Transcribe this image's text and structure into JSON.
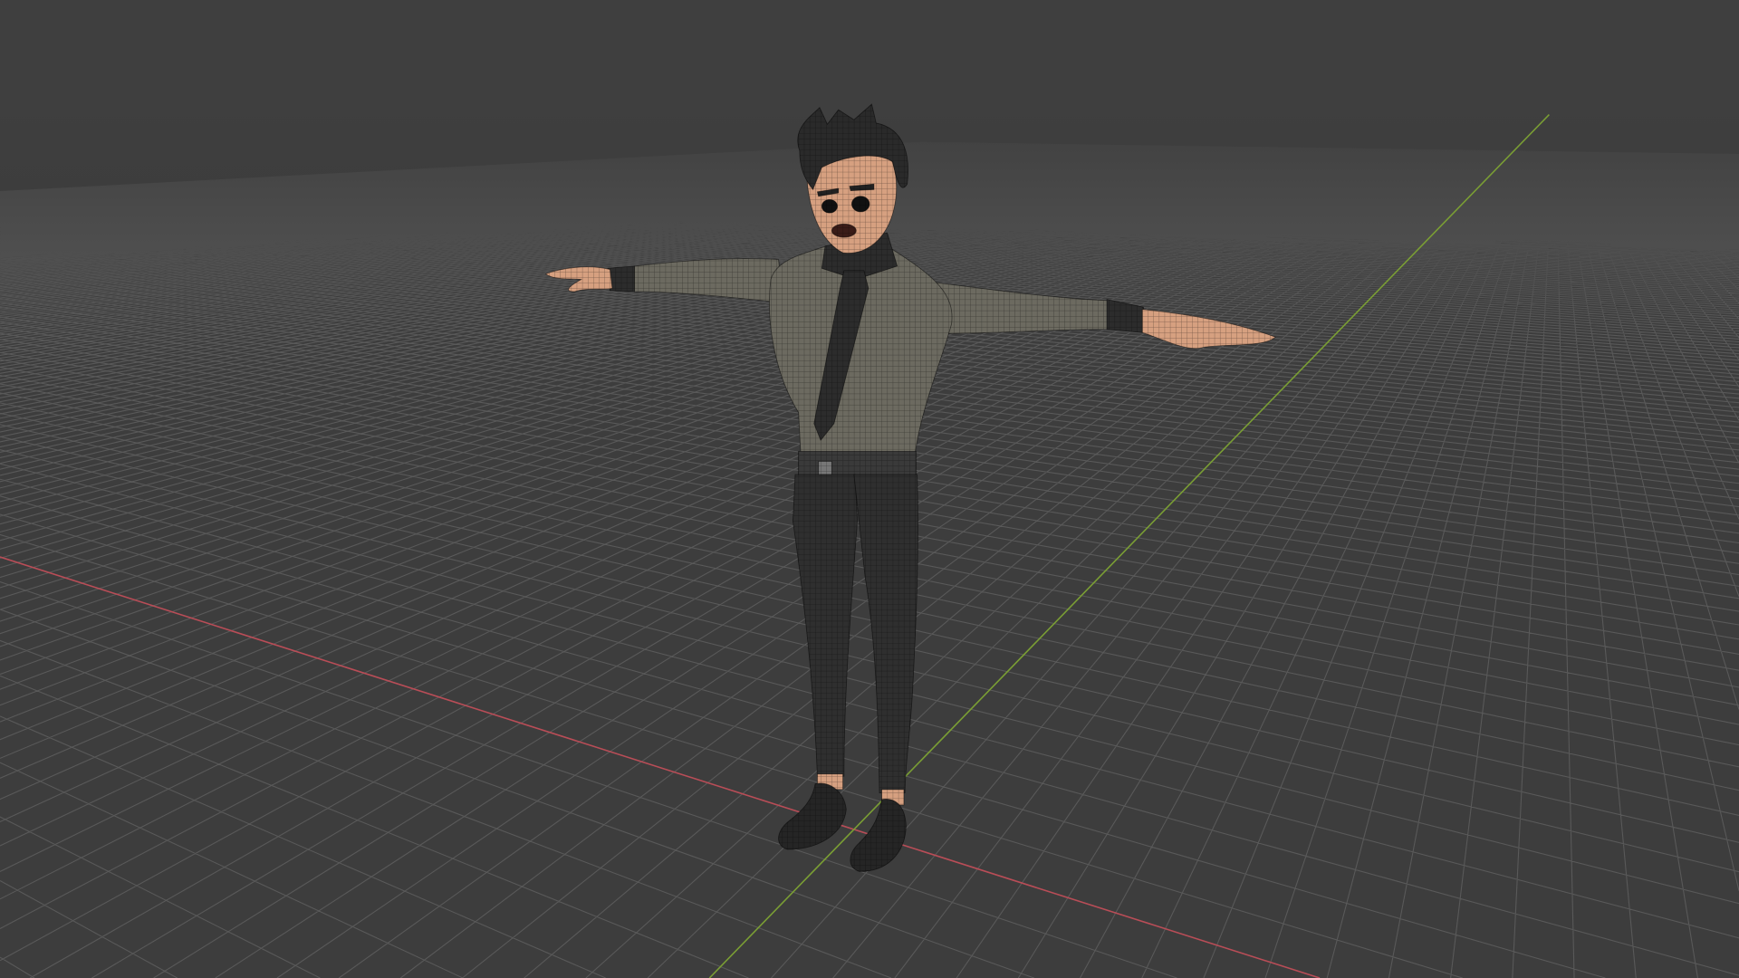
{
  "viewport": {
    "type": "3d-viewport",
    "colors": {
      "background": "#3d3d3d",
      "grid": "#5a5a5a",
      "x_axis": "#c0505a",
      "y_axis": "#7fa03a"
    }
  },
  "scene": {
    "object": "character-mesh-wireframe",
    "colors": {
      "skin": "#d6a080",
      "shirt": "#6c6a60",
      "pants": "#2f2f2f",
      "hair": "#2a2a2a",
      "shoes": "#252525",
      "tie": "#2c2c2c"
    }
  }
}
